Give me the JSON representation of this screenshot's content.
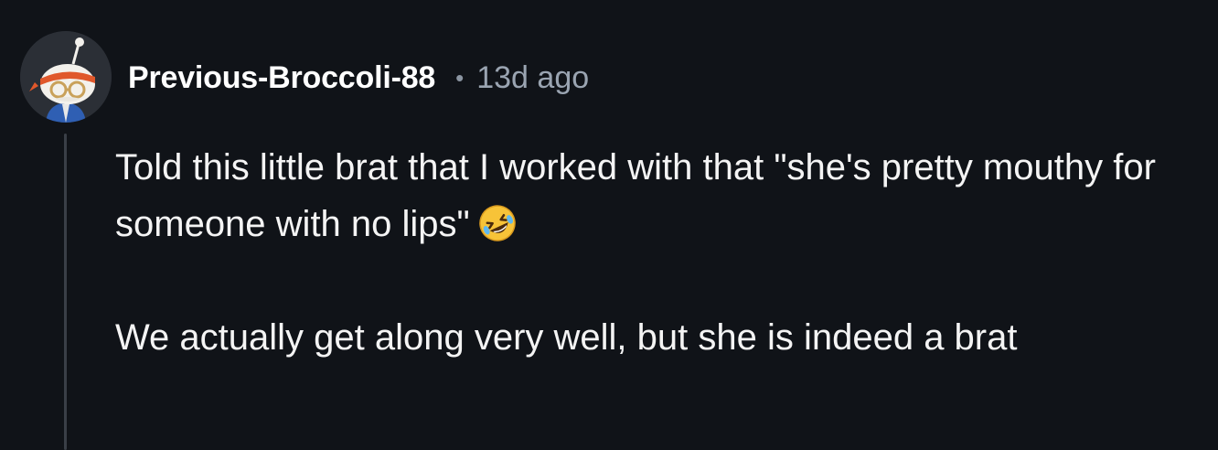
{
  "comment": {
    "author": "Previous-Broccoli-88",
    "separator": "•",
    "timestamp": "13d ago",
    "paragraphs": [
      "Told this little brat that I worked with that \"she's pretty mouthy for someone with no lips\"",
      "We actually get along very well, but she is indeed a brat"
    ],
    "emoji": "rolling-on-floor-laughing-emoji"
  }
}
